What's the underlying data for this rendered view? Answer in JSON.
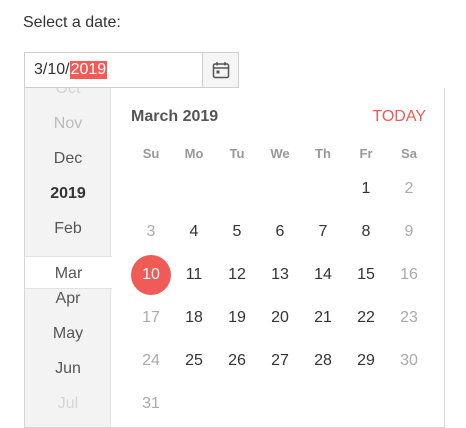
{
  "label": "Select a date:",
  "input": {
    "prefix": "3/10/",
    "selected_part": "2019"
  },
  "months_list": [
    {
      "label": "Oct",
      "style": "faded2"
    },
    {
      "label": "Nov",
      "style": "faded"
    },
    {
      "label": "Dec",
      "style": ""
    },
    {
      "label": "2019",
      "style": "year"
    },
    {
      "label": "Feb",
      "style": ""
    },
    {
      "label": "Mar",
      "style": "current"
    },
    {
      "label": "Apr",
      "style": ""
    },
    {
      "label": "May",
      "style": ""
    },
    {
      "label": "Jun",
      "style": ""
    },
    {
      "label": "Jul",
      "style": "faded2"
    }
  ],
  "calendar": {
    "title": "March 2019",
    "today_label": "TODAY",
    "weekdays": [
      "Su",
      "Mo",
      "Tu",
      "We",
      "Th",
      "Fr",
      "Sa"
    ],
    "first_weekday_index": 5,
    "days_in_month": 31,
    "selected_day": 10,
    "accent_color": "#f05a57"
  },
  "icons": {
    "calendar": "calendar-icon"
  }
}
